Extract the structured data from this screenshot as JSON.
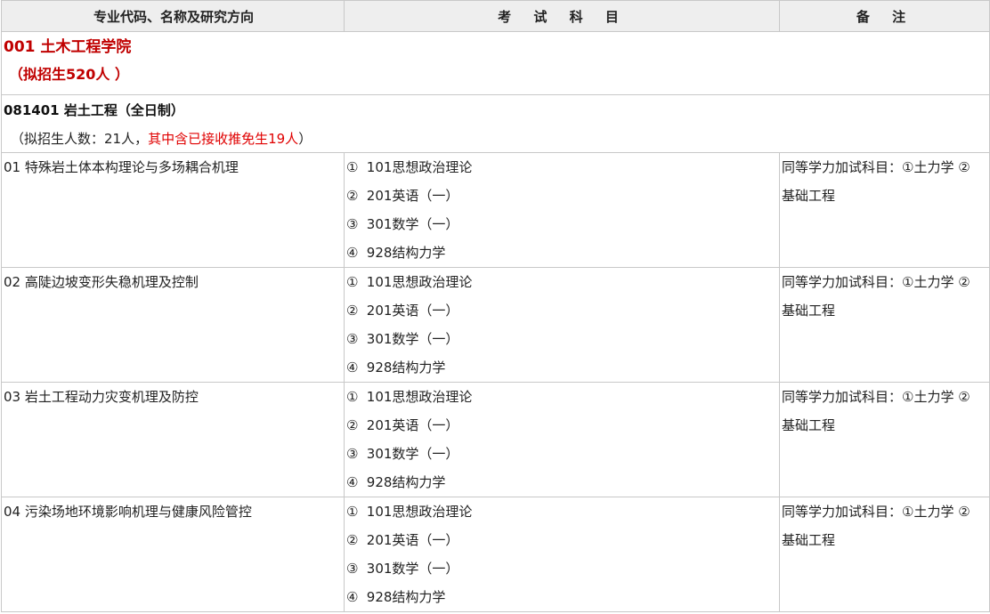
{
  "header": {
    "col1": "专业代码、名称及研究方向",
    "col2": "考 试 科 目",
    "col3": "备 注"
  },
  "college": {
    "name": "001 土木工程学院",
    "quota": "（拟招生520人 ）"
  },
  "major": {
    "title": "081401 岩土工程（全日制）",
    "quota_prefix": "（拟招生人数：21人，",
    "quota_highlight": "其中含已接收推免生19人",
    "quota_suffix": "）"
  },
  "directions": [
    {
      "name": "01 特殊岩土体本构理论与多场耦合机理",
      "subjects": [
        "101思想政治理论",
        "201英语（一）",
        "301数学（一）",
        "928结构力学"
      ],
      "note_line1": "同等学力加试科目：①土力学 ②",
      "note_line2": "基础工程"
    },
    {
      "name": "02 高陡边坡变形失稳机理及控制",
      "subjects": [
        "101思想政治理论",
        "201英语（一）",
        "301数学（一）",
        "928结构力学"
      ],
      "note_line1": "同等学力加试科目：①土力学 ②",
      "note_line2": "基础工程"
    },
    {
      "name": "03 岩土工程动力灾变机理及防控",
      "subjects": [
        "101思想政治理论",
        "201英语（一）",
        "301数学（一）",
        "928结构力学"
      ],
      "note_line1": "同等学力加试科目：①土力学 ②",
      "note_line2": "基础工程"
    },
    {
      "name": "04 污染场地环境影响机理与健康风险管控",
      "subjects": [
        "101思想政治理论",
        "201英语（一）",
        "301数学（一）",
        "928结构力学"
      ],
      "note_line1": "同等学力加试科目：①土力学 ②",
      "note_line2": "基础工程"
    }
  ],
  "markers": [
    "①",
    "②",
    "③",
    "④"
  ]
}
